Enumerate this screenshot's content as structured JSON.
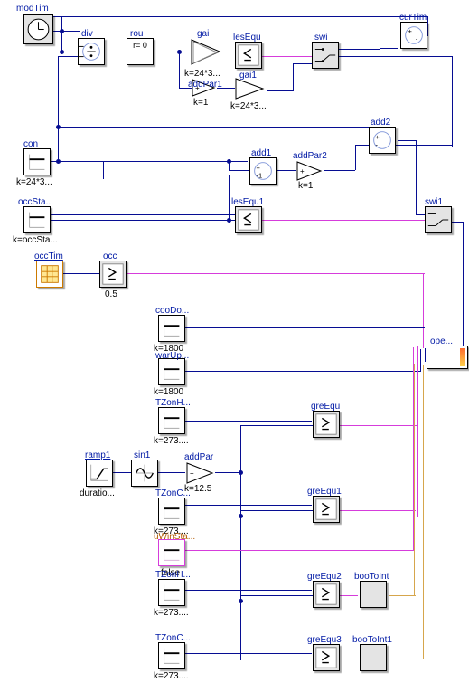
{
  "blocks": {
    "modTim": {
      "label": "modTim"
    },
    "div": {
      "label": "div"
    },
    "rou": {
      "label": "rou",
      "text": "r=\n0"
    },
    "gai": {
      "label": "gai",
      "k": "k=24*3..."
    },
    "lesEqu": {
      "label": "lesEqu"
    },
    "swi": {
      "label": "swi"
    },
    "curTim": {
      "label": "curTim"
    },
    "addPar1": {
      "label": "addPar1",
      "k": "k=1"
    },
    "gai1": {
      "label": "gai1",
      "k": "k=24*3..."
    },
    "add2": {
      "label": "add2"
    },
    "con": {
      "label": "con",
      "k": "k=24*3..."
    },
    "add1": {
      "label": "add1"
    },
    "addPar2": {
      "label": "addPar2",
      "k": "k=1"
    },
    "occSta": {
      "label": "occSta...",
      "k": "k=occSta..."
    },
    "lesEqu1": {
      "label": "lesEqu1"
    },
    "swi1": {
      "label": "swi1"
    },
    "occTim": {
      "label": "occTim"
    },
    "occ": {
      "label": "occ",
      "val": "0.5"
    },
    "cooDo": {
      "label": "cooDo...",
      "k": "k=1800"
    },
    "warUp": {
      "label": "warUp...",
      "k": "k=1800"
    },
    "TZonH": {
      "label": "TZonH...",
      "k": "k=273...."
    },
    "ramp1": {
      "label": "ramp1",
      "sub": "duratio..."
    },
    "sin1": {
      "label": "sin1"
    },
    "addPar": {
      "label": "addPar",
      "k": "k=12.5"
    },
    "greEqu": {
      "label": "greEqu"
    },
    "greEqu1": {
      "label": "greEqu1"
    },
    "TZonC": {
      "label": "TZonC...",
      "k": "k=273...."
    },
    "uWinSta": {
      "label": "uWinSta...",
      "val": "false"
    },
    "TZonH2": {
      "label": "TZonH...",
      "k": "k=273...."
    },
    "greEqu2": {
      "label": "greEqu2"
    },
    "booToInt": {
      "label": "booToInt"
    },
    "TZonC2": {
      "label": "TZonC...",
      "k": "k=273...."
    },
    "greEqu3": {
      "label": "greEqu3"
    },
    "booToInt1": {
      "label": "booToInt1"
    },
    "ope": {
      "label": "ope..."
    }
  }
}
